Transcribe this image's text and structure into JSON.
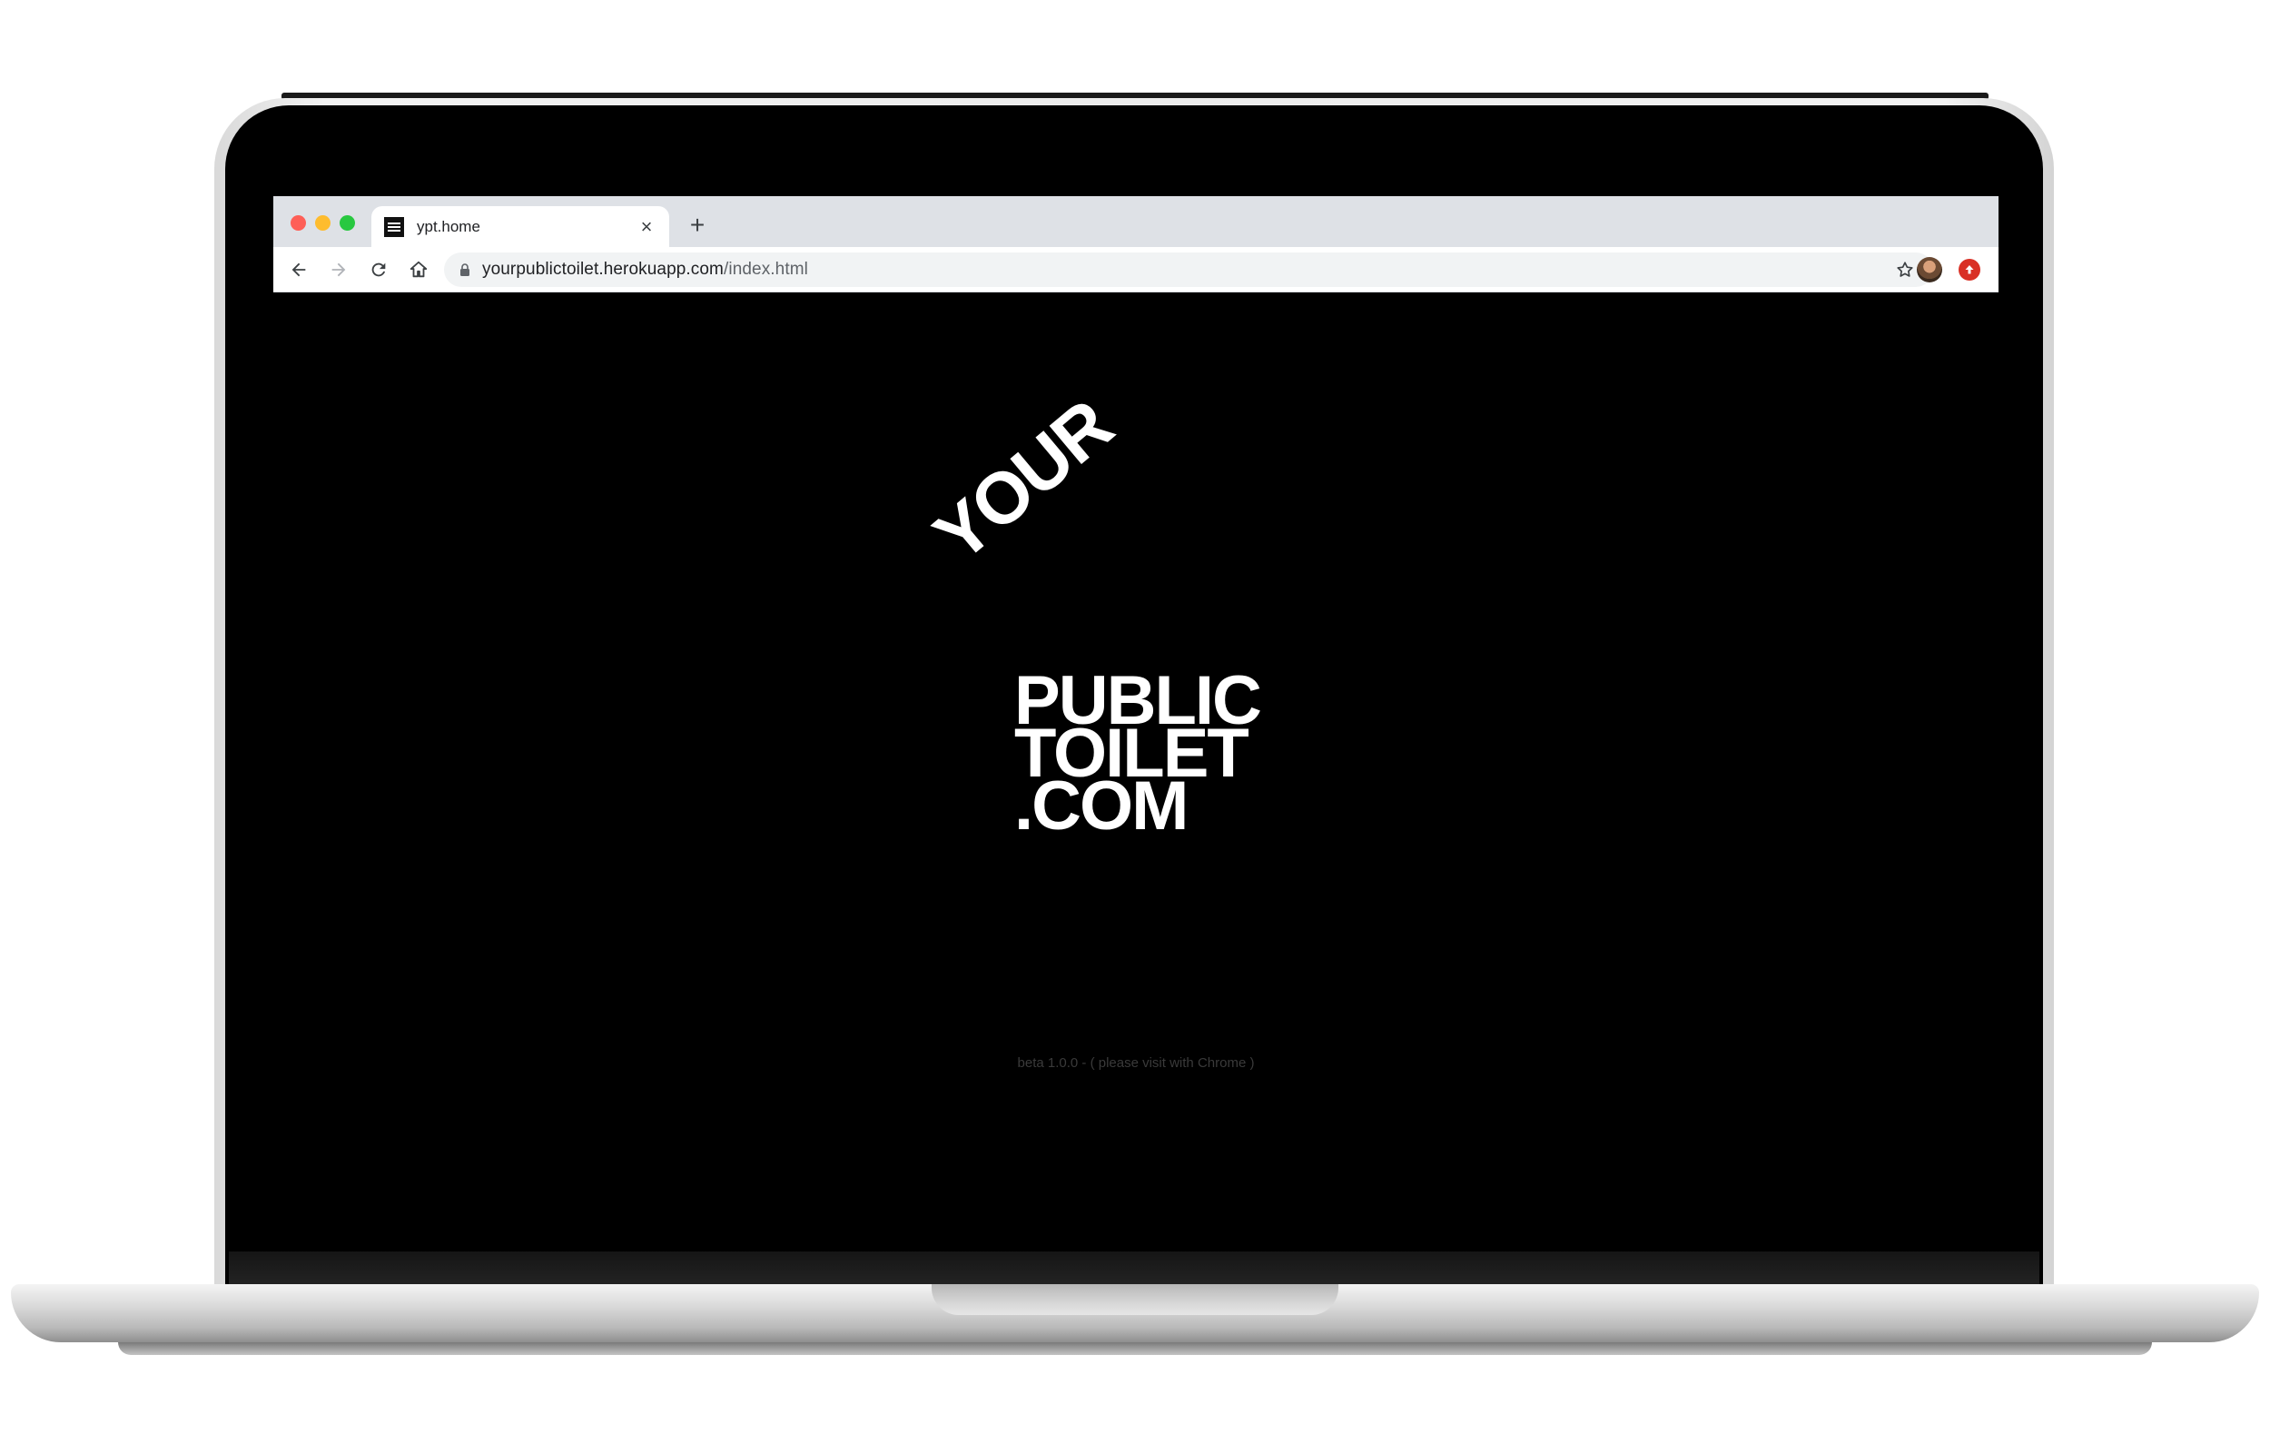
{
  "browser": {
    "tab_title": "ypt.home",
    "tab_close": "×",
    "new_tab": "+",
    "url_host": "yourpublictoilet.herokuapp.com",
    "url_path": "/index.html"
  },
  "page": {
    "logo": {
      "line1": "YOUR",
      "line2": "PUBLIC",
      "line3": "TOILET",
      "line4": ".COM"
    },
    "footer_note": "beta 1.0.0  -  ( please visit with Chrome )"
  },
  "icons": {
    "back": "arrow-left",
    "forward": "arrow-right",
    "reload": "reload",
    "home": "home",
    "lock": "lock",
    "bookmark": "star",
    "profile": "avatar",
    "extension": "upload-circle"
  },
  "colors": {
    "page_background": "#000000",
    "logo_text": "#ffffff",
    "close_dot": "#fe5f57",
    "minimize_dot": "#febc2e",
    "zoom_dot": "#28c840",
    "extension_red": "#d93025"
  }
}
